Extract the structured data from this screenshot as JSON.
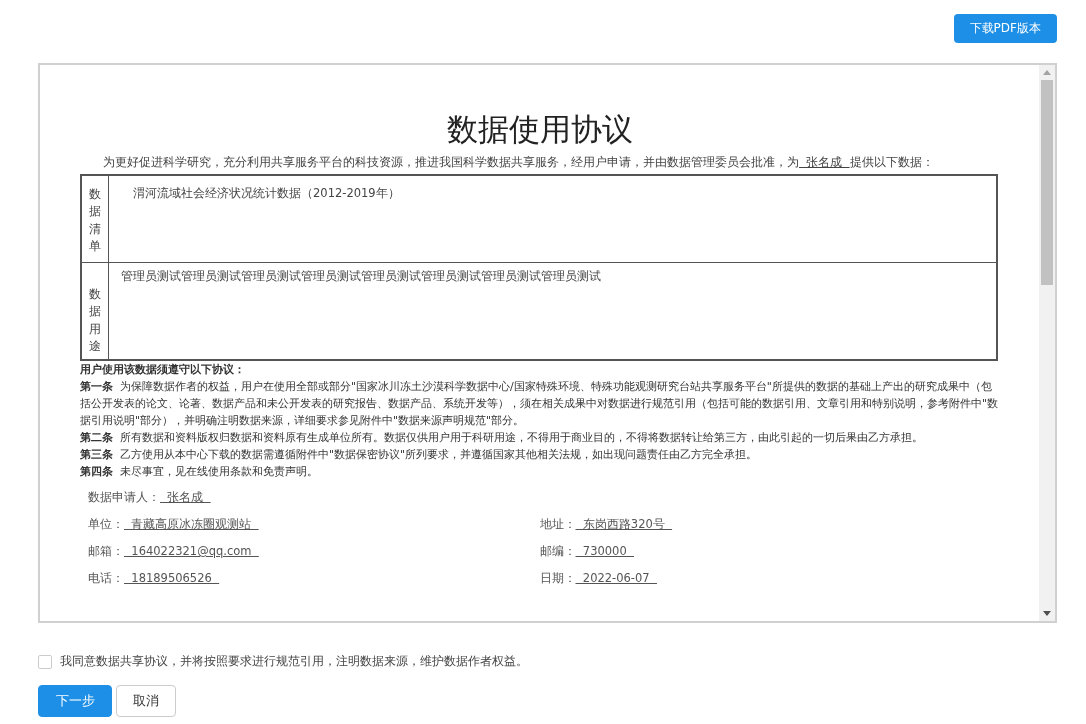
{
  "download_button": "下载PDF版本",
  "document": {
    "title": "数据使用协议",
    "intro": {
      "before": "为更好促进科学研究，充分利用共享服务平台的科技资源，推进我国科学数据共享服务，经用户申请，并由数据管理委员会批准，为",
      "name": "张名成",
      "after": "提供以下数据："
    },
    "table": [
      {
        "label": "数据清单",
        "content": "渭河流域社会经济状况统计数据（2012-2019年）"
      },
      {
        "label": "数据用途",
        "content": "管理员测试管理员测试管理员测试管理员测试管理员测试管理员测试管理员测试管理员测试"
      }
    ],
    "terms_heading": "用户使用该数据须遵守以下协议：",
    "articles": [
      {
        "label": "第一条",
        "text": "为保障数据作者的权益，用户在使用全部或部分\"国家冰川冻土沙漠科学数据中心/国家特殊环境、特殊功能观测研究台站共享服务平台\"所提供的数据的基础上产出的研究成果中（包括公开发表的论文、论著、数据产品和未公开发表的研究报告、数据产品、系统开发等），须在相关成果中对数据进行规范引用（包括可能的数据引用、文章引用和特别说明，参考附件中\"数据引用说明\"部分），并明确注明数据来源，详细要求参见附件中\"数据来源声明规范\"部分。"
      },
      {
        "label": "第二条",
        "text": "所有数据和资料版权归数据和资料原有生成单位所有。数据仅供用户用于科研用途，不得用于商业目的，不得将数据转让给第三方，由此引起的一切后果由乙方承担。"
      },
      {
        "label": "第三条",
        "text": "乙方使用从本中心下载的数据需遵循附件中\"数据保密协议\"所列要求，并遵循国家其他相关法规，如出现问题责任由乙方完全承担。"
      },
      {
        "label": "第四条",
        "text": "未尽事宜，见在线使用条款和免责声明。"
      }
    ],
    "applicant": {
      "label": "数据申请人：",
      "value": "张名成"
    },
    "info_rows": [
      [
        {
          "label": "单位：",
          "value": "青藏高原冰冻圈观测站"
        },
        {
          "label": "地址：",
          "value": "东岗西路320号"
        }
      ],
      [
        {
          "label": "邮箱：",
          "value": "164022321@qq.com"
        },
        {
          "label": "邮编：",
          "value": "730000"
        }
      ],
      [
        {
          "label": "电话：",
          "value": "18189506526"
        },
        {
          "label": "日期：",
          "value": "2022-06-07"
        }
      ]
    ]
  },
  "agreement": {
    "checked": false,
    "text": "我同意数据共享协议，并将按照要求进行规范引用，注明数据来源，维护数据作者权益。"
  },
  "buttons": [
    {
      "label": "下一步",
      "kind": "primary"
    },
    {
      "label": "取消",
      "kind": "default"
    }
  ]
}
